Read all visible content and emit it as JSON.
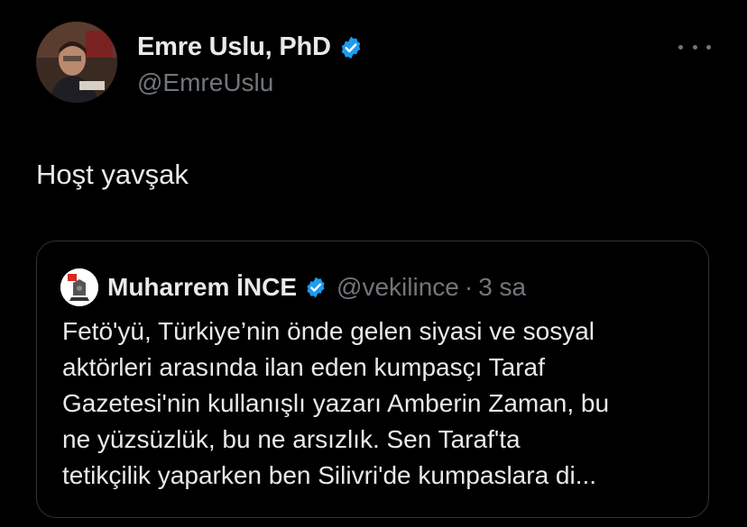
{
  "tweet": {
    "author_name": "Emre Uslu, PhD",
    "author_handle": "@EmreUslu",
    "text": "Hoşt yavşak",
    "more_icon": "more-horizontal-icon",
    "verified_color": "#1d9bf0"
  },
  "quoted_tweet": {
    "author_name": "Muharrem İNCE",
    "author_handle": "@vekilince",
    "separator": "·",
    "time": "3 sa",
    "text": "Fetö'yü, Türkiye’nin önde gelen siyasi ve sosyal\naktörleri arasında ilan eden kumpasçı Taraf\nGazetesi'nin kullanışlı yazarı Amberin Zaman, bu\nne yüzsüzlük, bu ne arsızlık. Sen Taraf'ta\ntetikçilik yaparken ben Silivri'de kumpaslara di..."
  }
}
